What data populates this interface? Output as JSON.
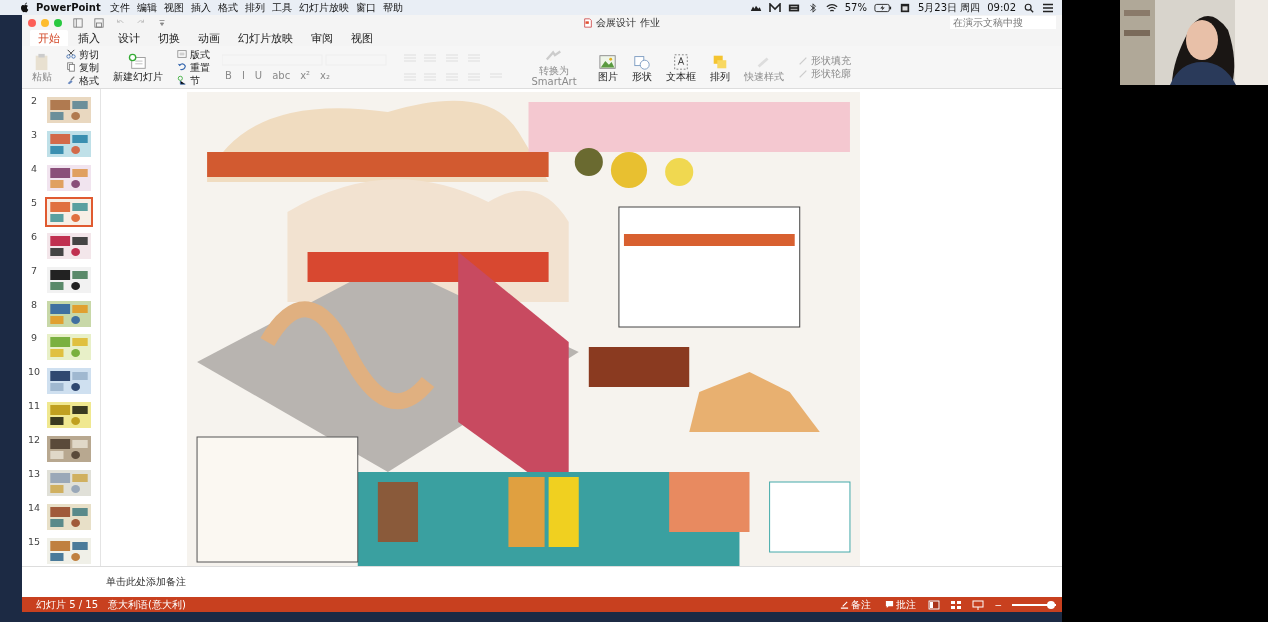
{
  "menu_bar": {
    "app": "PowerPoint",
    "items": [
      "文件",
      "编辑",
      "视图",
      "插入",
      "格式",
      "排列",
      "工具",
      "幻灯片放映",
      "窗口",
      "帮助"
    ],
    "battery": "57%",
    "date": "5月23日 周四",
    "time": "09:02"
  },
  "window": {
    "title": "会展设计 作业",
    "search": {
      "placeholder": "在演示文稿中搜"
    }
  },
  "tabs": [
    {
      "label": "开始",
      "selected": true
    },
    {
      "label": "插入",
      "selected": false
    },
    {
      "label": "设计",
      "selected": false
    },
    {
      "label": "切换",
      "selected": false
    },
    {
      "label": "动画",
      "selected": false
    },
    {
      "label": "幻灯片放映",
      "selected": false
    },
    {
      "label": "审阅",
      "selected": false
    },
    {
      "label": "视图",
      "selected": false
    }
  ],
  "ribbon": [
    {
      "kind": "large",
      "label": "粘贴",
      "disabled": true
    },
    {
      "kind": "stack",
      "items": [
        {
          "label": "剪切",
          "disabled": false
        },
        {
          "label": "复制",
          "disabled": false
        },
        {
          "label": "格式",
          "disabled": false
        }
      ]
    },
    {
      "kind": "large",
      "label": "新建幻灯片",
      "disabled": false
    },
    {
      "kind": "stack",
      "items": [
        {
          "label": "版式",
          "disabled": false
        },
        {
          "label": "重置",
          "disabled": false
        },
        {
          "label": "节",
          "disabled": false
        }
      ]
    },
    {
      "kind": "glyphs",
      "items": [
        {
          "label": "B",
          "disabled": true
        },
        {
          "label": "I",
          "disabled": true
        },
        {
          "label": "U",
          "disabled": true
        },
        {
          "label": "abc",
          "disabled": true
        },
        {
          "label": "x²",
          "disabled": true
        },
        {
          "label": "x₂",
          "disabled": true
        }
      ]
    },
    {
      "kind": "paragraph"
    },
    {
      "kind": "large",
      "label": "转换为SmartArt",
      "disabled": true
    },
    {
      "kind": "large",
      "label": "图片",
      "disabled": false
    },
    {
      "kind": "large",
      "label": "形状",
      "disabled": false
    },
    {
      "kind": "large",
      "label": "文本框",
      "disabled": false
    },
    {
      "kind": "large",
      "label": "排列",
      "disabled": false
    },
    {
      "kind": "large",
      "label": "快速样式",
      "disabled": true
    },
    {
      "kind": "stack",
      "items": [
        {
          "label": "形状填充",
          "disabled": true
        },
        {
          "label": "形状轮廓",
          "disabled": true
        }
      ]
    }
  ],
  "slides": [
    {
      "number": "2",
      "selected": false
    },
    {
      "number": "3",
      "selected": false
    },
    {
      "number": "4",
      "selected": false
    },
    {
      "number": "5",
      "selected": true
    },
    {
      "number": "6",
      "selected": false
    },
    {
      "number": "7",
      "selected": false
    },
    {
      "number": "8",
      "selected": false
    },
    {
      "number": "9",
      "selected": false
    },
    {
      "number": "10",
      "selected": false
    },
    {
      "number": "11",
      "selected": false
    },
    {
      "number": "12",
      "selected": false
    },
    {
      "number": "13",
      "selected": false
    },
    {
      "number": "14",
      "selected": false
    },
    {
      "number": "15",
      "selected": false
    }
  ],
  "notes": {
    "placeholder": "单击此处添加备注"
  },
  "status_bar": {
    "slide_counter": "幻灯片 5 / 15",
    "language": "意大利语(意大利)",
    "notes_button": "备注",
    "comments_button": "批注",
    "zoom_out": "−",
    "zoom": {
      "level": 0.88
    }
  }
}
